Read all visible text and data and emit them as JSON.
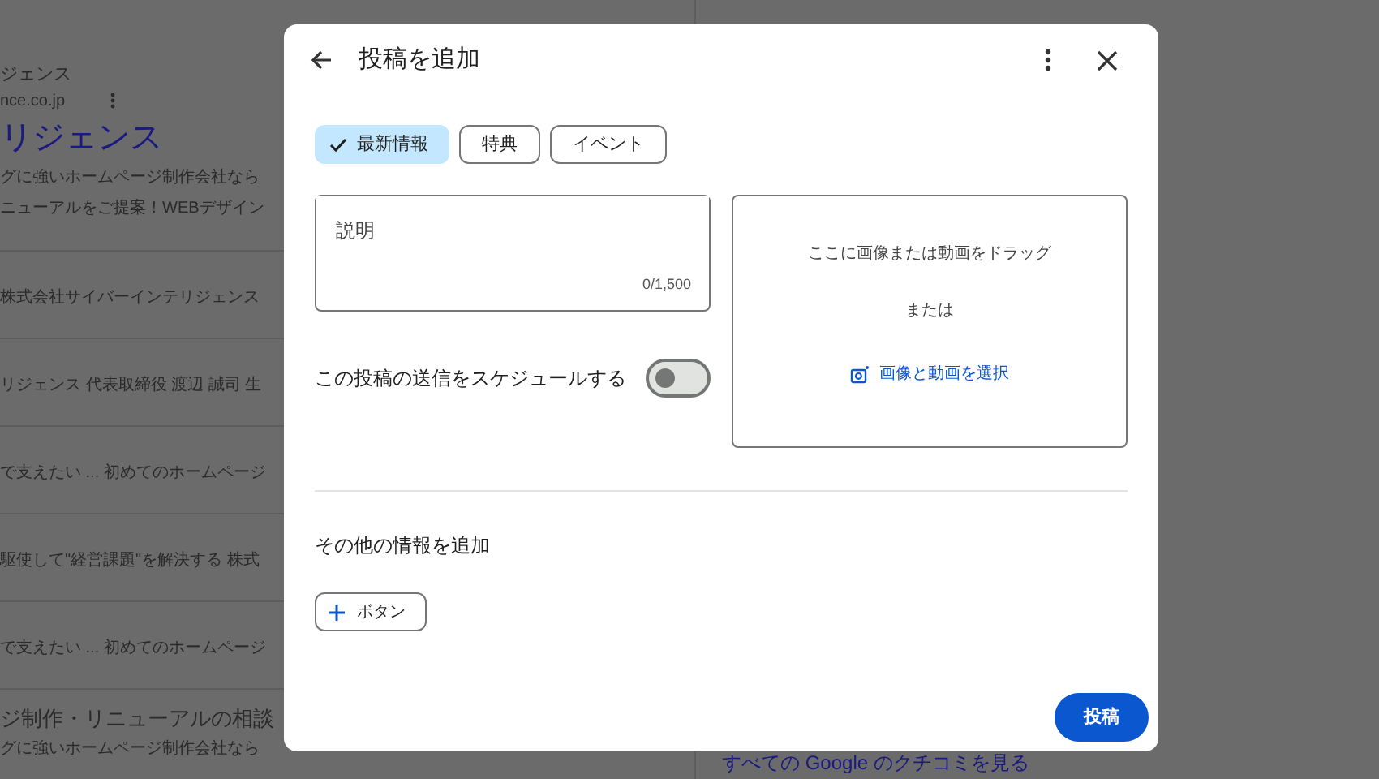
{
  "background_page": {
    "left_items": [
      {
        "kind": "small",
        "text": "ジェンス"
      },
      {
        "kind": "url",
        "text": "nce.co.jp"
      },
      {
        "kind": "heading",
        "text": "リジェンス"
      },
      {
        "kind": "snippet",
        "text": "グに強いホームページ制作会社なら"
      },
      {
        "kind": "snippet_last",
        "text": "ニューアルをご提案！WEBデザイン"
      },
      {
        "kind": "row",
        "text": "株式会社サイバーインテリジェンス"
      },
      {
        "kind": "row",
        "text": "リジェンス 代表取締役 渡辺 誠司 生"
      },
      {
        "kind": "row",
        "text": "で支えたい ... 初めてのホームページ"
      },
      {
        "kind": "row",
        "text": "駆使して\"経営課題\"を解決する 株式"
      },
      {
        "kind": "row",
        "text": "で支えたい ... 初めてのホームページ"
      },
      {
        "kind": "title",
        "text": "ジ制作・リニューアルの相談"
      },
      {
        "kind": "snippet",
        "text": "グに強いホームページ制作会社なら"
      }
    ],
    "reviews_link": "すべての Google のクチコミを見る"
  },
  "dialog": {
    "title": "投稿を追加",
    "chips": [
      {
        "label": "最新情報",
        "selected": true
      },
      {
        "label": "特典",
        "selected": false
      },
      {
        "label": "イベント",
        "selected": false
      }
    ],
    "description": {
      "placeholder": "説明",
      "counter": "0/1,500"
    },
    "schedule": {
      "label": "この投稿の送信をスケジュールする",
      "on": false
    },
    "dropzone": {
      "hint": "ここに画像または動画をドラッグ",
      "or": "または",
      "select_link": "画像と動画を選択"
    },
    "more_info": {
      "heading": "その他の情報を追加",
      "button": "ボタン"
    },
    "submit": "投稿"
  }
}
